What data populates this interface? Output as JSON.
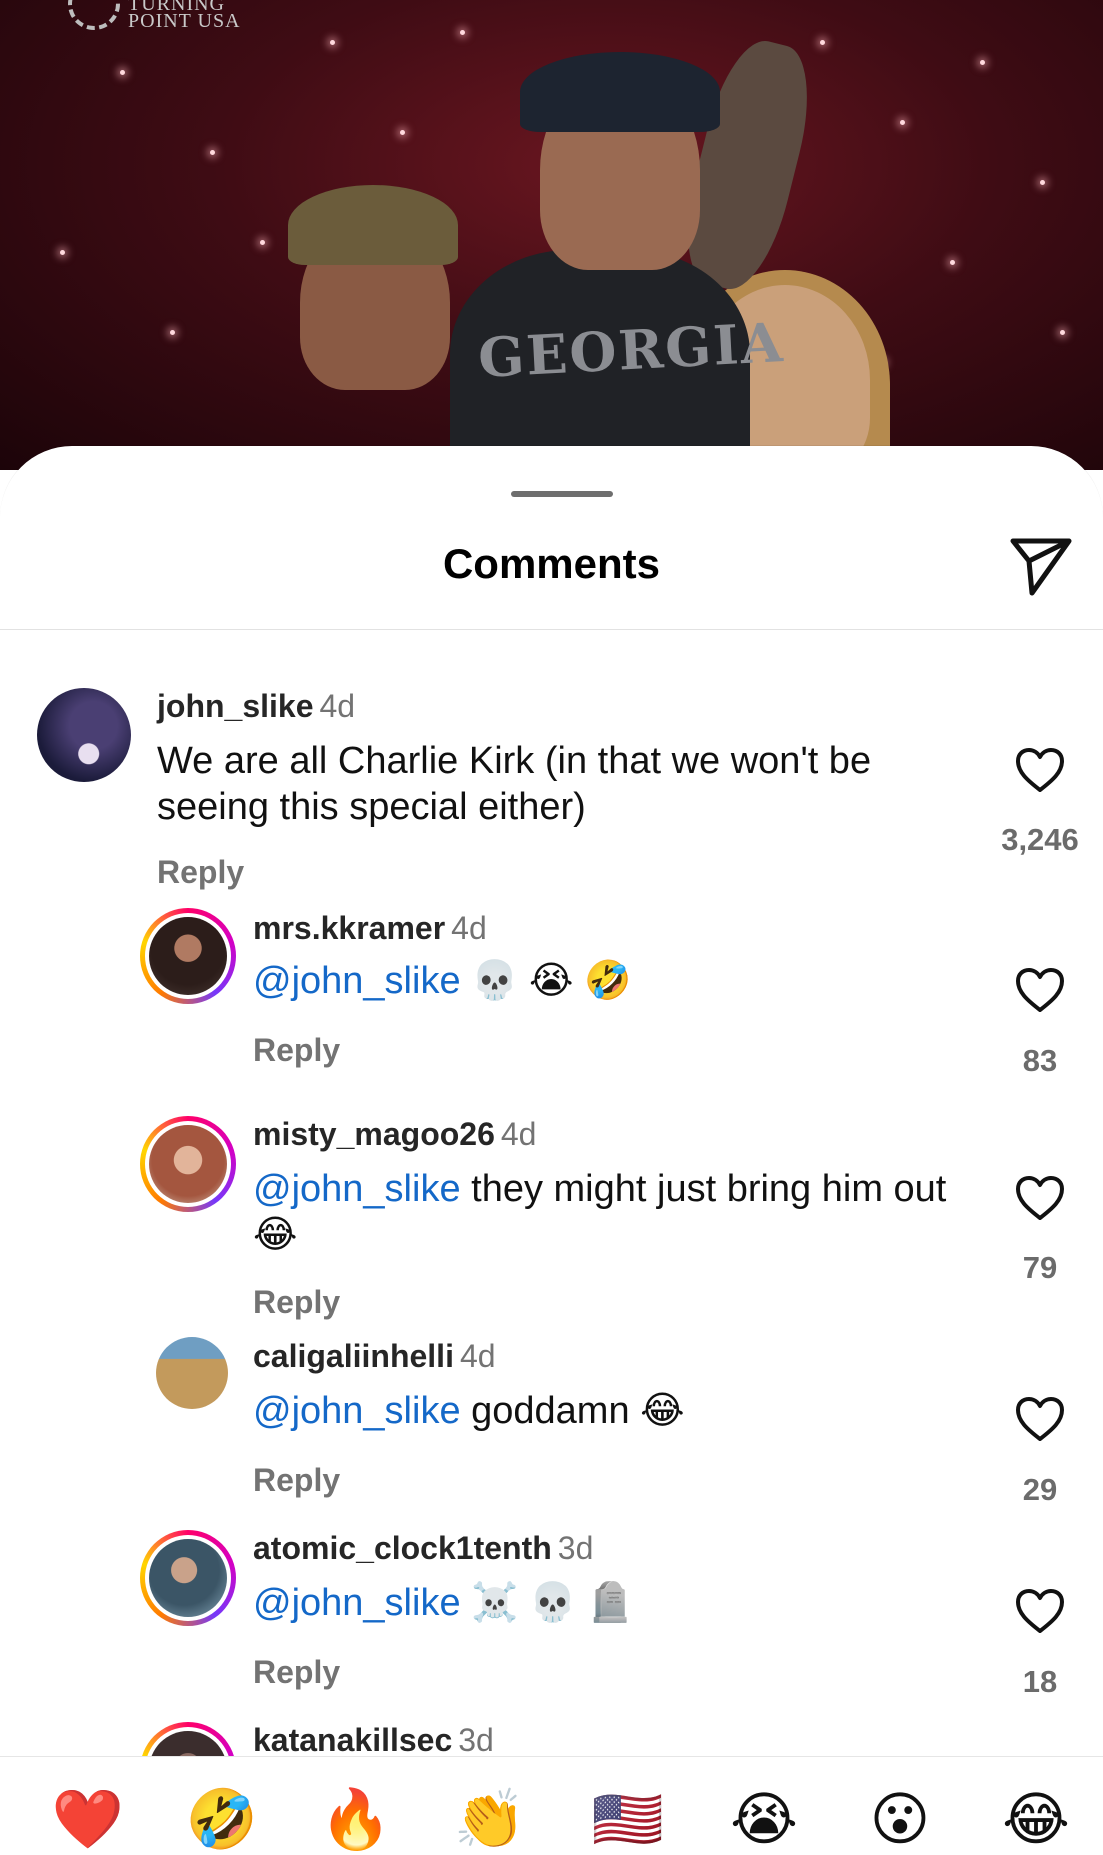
{
  "backdrop": {
    "logo_line1": "TURNING",
    "logo_line2": "POINT USA",
    "shirt_text": "GEORGIA"
  },
  "sheet": {
    "title": "Comments",
    "share_icon": "send-icon"
  },
  "comments": [
    {
      "username": "john_slike",
      "time": "4d",
      "mention": "",
      "text": "We are all Charlie Kirk (in that we won't be seeing this special either)",
      "reply_label": "Reply",
      "likes": "3,246",
      "avatar_color": "#1b1b3a"
    },
    {
      "username": "mrs.kkramer",
      "time": "4d",
      "mention": "@john_slike",
      "text": " 💀 😭 🤣",
      "reply_label": "Reply",
      "likes": "83",
      "avatar_color": "#3a2a24"
    },
    {
      "username": "misty_magoo26",
      "time": "4d",
      "mention": "@john_slike",
      "text": " they might just bring him out 😂",
      "reply_label": "Reply",
      "likes": "79",
      "avatar_color": "#a4563f"
    },
    {
      "username": "caligaliinhelli",
      "time": "4d",
      "mention": "@john_slike",
      "text": " goddamn 😂",
      "reply_label": "Reply",
      "likes": "29",
      "avatar_color": "#c39a5c"
    },
    {
      "username": "atomic_clock1tenth",
      "time": "3d",
      "mention": "@john_slike",
      "text": " ☠️ 💀 🪦",
      "reply_label": "Reply",
      "likes": "18",
      "avatar_color": "#4f6c7e"
    },
    {
      "username": "katanakillsec",
      "time": "3d",
      "avatar_color": "#3b2d2d"
    }
  ],
  "reactions": [
    "❤️",
    "🤣",
    "🔥",
    "👏",
    "🇺🇸",
    "😭",
    "😮",
    "😂"
  ],
  "colors": {
    "mention": "#1468c8",
    "muted": "#737373",
    "story_ring": "#ff0069"
  }
}
